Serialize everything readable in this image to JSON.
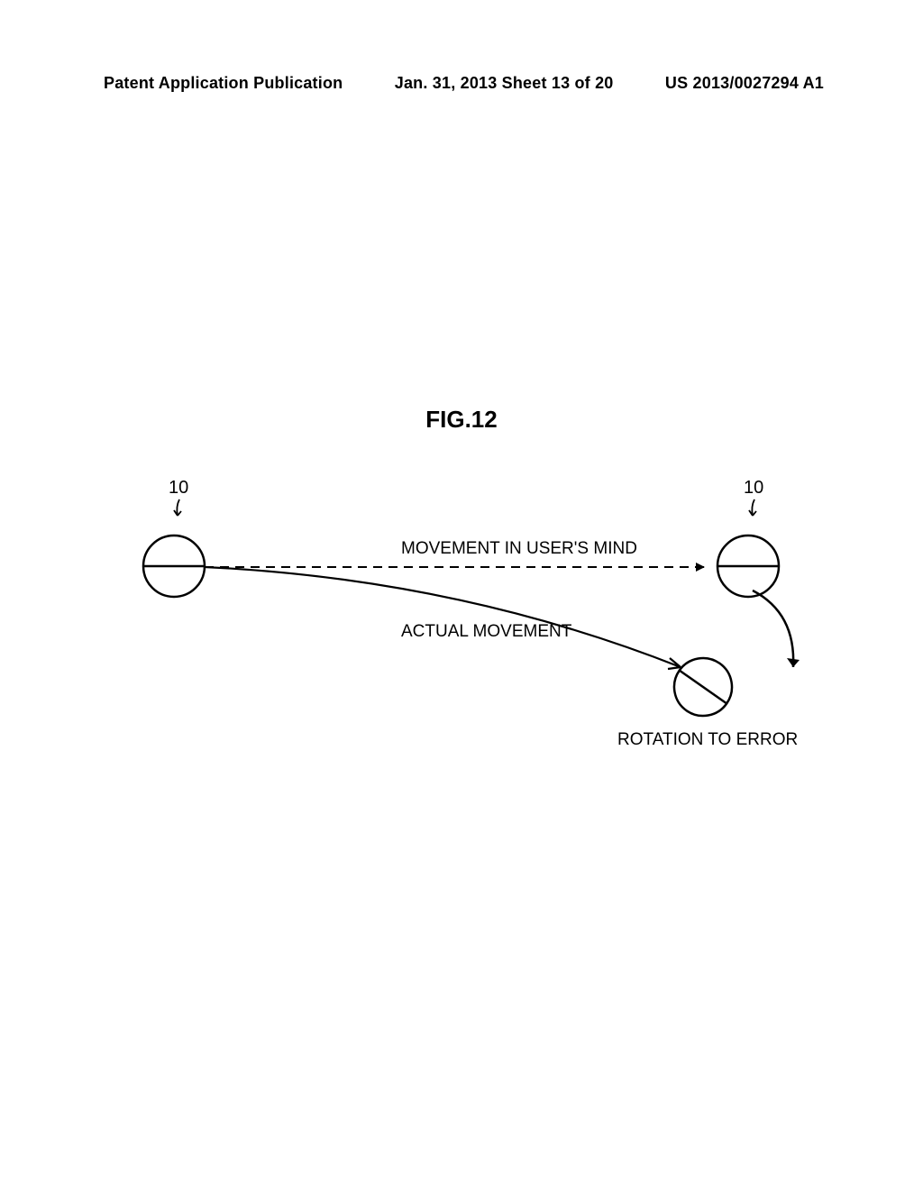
{
  "header": {
    "left": "Patent Application Publication",
    "center": "Jan. 31, 2013  Sheet 13 of 20",
    "right": "US 2013/0027294 A1"
  },
  "figure": {
    "title": "FIG.12",
    "ref_left": "10",
    "ref_right": "10",
    "label_users_mind": "MOVEMENT IN USER'S MIND",
    "label_actual": "ACTUAL MOVEMENT",
    "label_rotation": "ROTATION TO ERROR"
  }
}
